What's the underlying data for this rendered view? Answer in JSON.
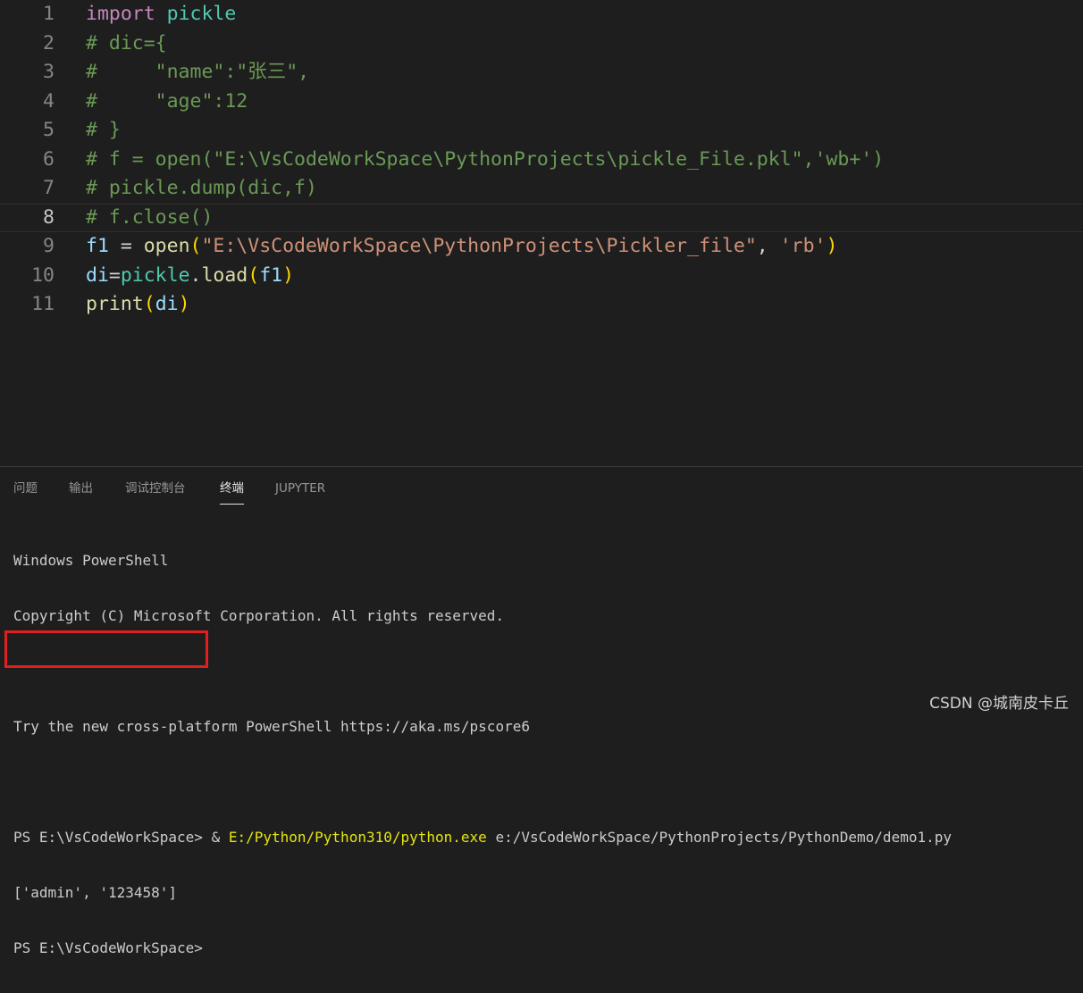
{
  "editor": {
    "lines": [
      {
        "num": "1",
        "tokens": [
          [
            "kw",
            "import"
          ],
          [
            "plain",
            " "
          ],
          [
            "mod",
            "pickle"
          ]
        ]
      },
      {
        "num": "2",
        "tokens": [
          [
            "cmt",
            "# dic={"
          ]
        ]
      },
      {
        "num": "3",
        "tokens": [
          [
            "cmt",
            "#     \"name\":\"张三\","
          ]
        ]
      },
      {
        "num": "4",
        "tokens": [
          [
            "cmt",
            "#     \"age\":12"
          ]
        ]
      },
      {
        "num": "5",
        "tokens": [
          [
            "cmt",
            "# }"
          ]
        ]
      },
      {
        "num": "6",
        "tokens": [
          [
            "cmt",
            "# f = open(\"E:\\VsCodeWorkSpace\\PythonProjects\\pickle_File.pkl\",'wb+')"
          ]
        ]
      },
      {
        "num": "7",
        "tokens": [
          [
            "cmt",
            "# pickle.dump(dic,f)"
          ]
        ]
      },
      {
        "num": "8",
        "current": true,
        "tokens": [
          [
            "cmt",
            "# f.close()"
          ]
        ]
      },
      {
        "num": "9",
        "tokens": [
          [
            "var",
            "f1"
          ],
          [
            "plain",
            " = "
          ],
          [
            "fn",
            "open"
          ],
          [
            "paren",
            "("
          ],
          [
            "str",
            "\"E:\\VsCodeWorkSpace\\PythonProjects\\Pickler_file\""
          ],
          [
            "plain",
            ", "
          ],
          [
            "str",
            "'rb'"
          ],
          [
            "paren",
            ")"
          ]
        ]
      },
      {
        "num": "10",
        "tokens": [
          [
            "var",
            "di"
          ],
          [
            "plain",
            "="
          ],
          [
            "mod",
            "pickle"
          ],
          [
            "plain",
            "."
          ],
          [
            "fn",
            "load"
          ],
          [
            "paren",
            "("
          ],
          [
            "var",
            "f1"
          ],
          [
            "paren",
            ")"
          ]
        ]
      },
      {
        "num": "11",
        "tokens": [
          [
            "fn",
            "print"
          ],
          [
            "paren",
            "("
          ],
          [
            "var",
            "di"
          ],
          [
            "paren",
            ")"
          ]
        ]
      }
    ]
  },
  "panel": {
    "tabs": [
      {
        "label": "问题",
        "active": false
      },
      {
        "label": "输出",
        "active": false
      },
      {
        "label": "调试控制台",
        "active": false
      },
      {
        "label": "终端",
        "active": true
      },
      {
        "label": "JUPYTER",
        "active": false
      }
    ],
    "terminal": {
      "line1": "Windows PowerShell",
      "line2": "Copyright (C) Microsoft Corporation. All rights reserved.",
      "line3": "",
      "line4": "Try the new cross-platform PowerShell https://aka.ms/pscore6",
      "line5": "",
      "prompt1": "PS E:\\VsCodeWorkSpace> ",
      "cmd_amp": "& ",
      "cmd_exe": "E:/Python/Python310/python.exe",
      "cmd_arg": " e:/VsCodeWorkSpace/PythonProjects/PythonDemo/demo1.py",
      "output": "['admin', '123458']",
      "prompt2": "PS E:\\VsCodeWorkSpace>"
    }
  },
  "watermark": "CSDN @城南皮卡丘"
}
